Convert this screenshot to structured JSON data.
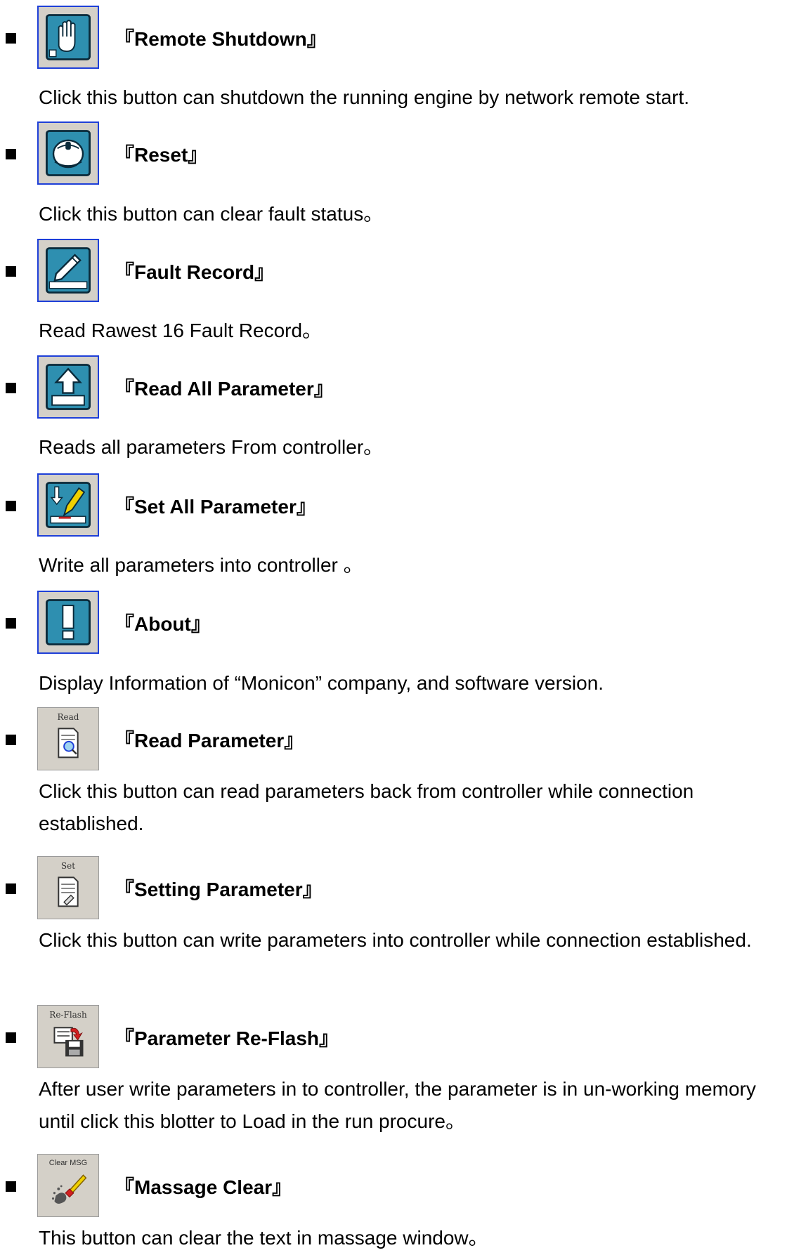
{
  "items": [
    {
      "title": "『Remote Shutdown』",
      "desc": "Click this button can shutdown the running engine by network remote start.",
      "icon": "hand-stop-icon"
    },
    {
      "title": "『Reset』",
      "desc": "Click this button can clear fault status。",
      "icon": "reset-mouse-icon"
    },
    {
      "title": "『Fault Record』",
      "desc": "Read Rawest 16 Fault Record。",
      "icon": "pencil-record-icon"
    },
    {
      "title": "『Read All Parameter』",
      "desc": "Reads all parameters From controller。",
      "icon": "upload-arrow-icon"
    },
    {
      "title": "『Set All Parameter』",
      "desc": "Write all parameters into controller  。",
      "icon": "download-pen-icon"
    },
    {
      "title": "『About』",
      "desc": "Display Information of “Monicon” company, and software version.",
      "icon": "exclamation-icon"
    },
    {
      "title": "『Read Parameter』",
      "desc": "Click this button can read parameters back from controller while connection established.",
      "icon": "read-doc-icon",
      "caption": "Read"
    },
    {
      "title": "『Setting Parameter』",
      "desc": "Click this button can write parameters into controller while connection established.",
      "icon": "set-doc-icon",
      "caption": "Set"
    },
    {
      "title": "『Parameter Re-Flash』",
      "desc": "After user write parameters in to controller, the parameter is in un-working memory until click this blotter to Load in the run procure。",
      "icon": "reflash-floppy-icon",
      "caption": "Re-Flash"
    },
    {
      "title": "『Massage Clear』",
      "desc": "This button can clear the text in massage window。",
      "icon": "clear-msg-brush-icon",
      "caption": "Clear MSG"
    }
  ],
  "colors": {
    "icon_teal": "#2e8fb0",
    "icon_dark": "#0a2a3a",
    "frame_blue": "#1e3fd8",
    "button_face": "#d4d0c8"
  }
}
